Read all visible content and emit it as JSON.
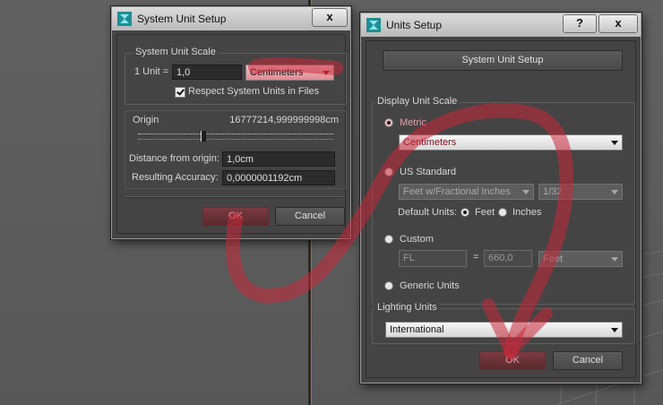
{
  "colors": {
    "accent_highlight": "#c83848",
    "window_bg": "#444444",
    "titlebar": "#cfcfcf"
  },
  "system_unit_dialog": {
    "title": "System Unit Setup",
    "close_label": "x",
    "scale_group_label": "System Unit Scale",
    "unit_label": "1 Unit =",
    "unit_value": "1,0",
    "unit_type": "Centimeters",
    "respect_label": "Respect System Units in Files",
    "origin_label": "Origin",
    "origin_value": "16777214,999999998cm",
    "distance_label": "Distance from origin:",
    "distance_value": "1,0cm",
    "accuracy_label": "Resulting Accuracy:",
    "accuracy_value": "0,0000001192cm",
    "ok_label": "OK",
    "cancel_label": "Cancel"
  },
  "units_dialog": {
    "title": "Units Setup",
    "help_label": "?",
    "close_label": "x",
    "system_unit_button": "System Unit Setup",
    "display_group_label": "Display Unit Scale",
    "metric_label": "Metric",
    "metric_value": "Centimeters",
    "us_label": "US Standard",
    "us_value": "Feet w/Fractional Inches",
    "fraction_value": "1/32",
    "default_units_label": "Default Units:",
    "feet_label": "Feet",
    "inches_label": "Inches",
    "custom_label": "Custom",
    "custom_name": "FL",
    "equals": "=",
    "custom_value": "660,0",
    "custom_unit": "Feet",
    "generic_label": "Generic Units",
    "lighting_group_label": "Lighting Units",
    "lighting_value": "International",
    "ok_label": "OK",
    "cancel_label": "Cancel"
  }
}
